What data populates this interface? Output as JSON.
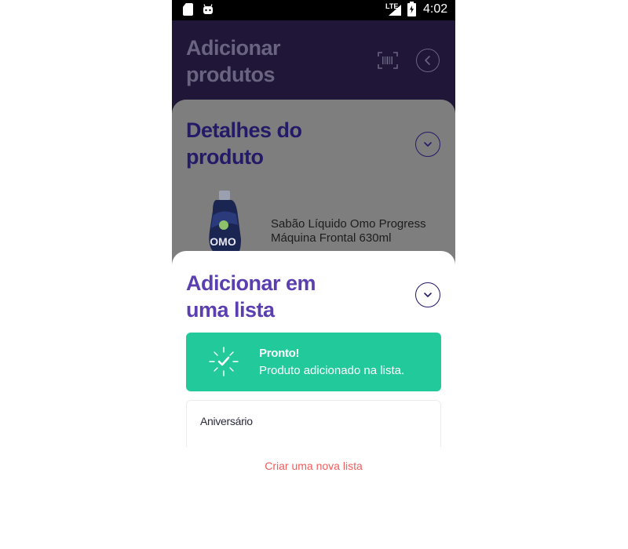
{
  "status_bar": {
    "network": "LTE",
    "time": "4:02"
  },
  "header": {
    "title": "Adicionar produtos"
  },
  "product_details": {
    "title": "Detalhes do produto",
    "product_name": "Sabão Líquido Omo Progress Máquina Frontal 630ml",
    "product_brand_text": "OMO"
  },
  "add_to_list": {
    "title": "Adicionar em uma lista",
    "success": {
      "title": "Pronto!",
      "message": "Produto adicionado na lista."
    },
    "lists": [
      {
        "label": "Aniversário"
      }
    ],
    "new_list_label": "Criar uma nova lista"
  },
  "colors": {
    "header_bg": "#201638",
    "accent_purple": "#5b3fb0",
    "success_green": "#22c99b",
    "link_red": "#f25c5c"
  },
  "icons": [
    "sd-card-icon",
    "android-icon",
    "signal-icon",
    "battery-icon",
    "barcode-scan-icon",
    "back-arrow-icon",
    "chevron-down-icon",
    "sparkle-check-icon"
  ]
}
